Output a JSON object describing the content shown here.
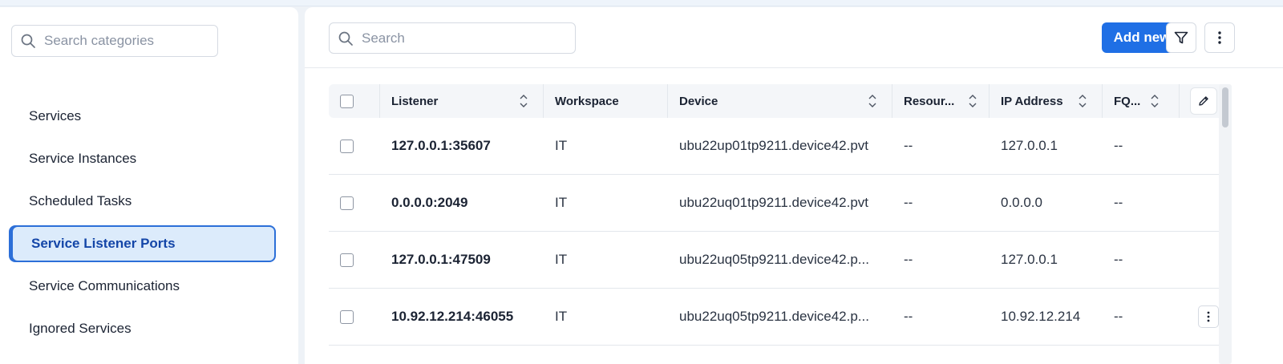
{
  "sidebar": {
    "search_placeholder": "Search categories",
    "items": [
      {
        "label": "Services",
        "active": false
      },
      {
        "label": "Service Instances",
        "active": false
      },
      {
        "label": "Scheduled Tasks",
        "active": false
      },
      {
        "label": "Service Listener Ports",
        "active": true
      },
      {
        "label": "Service Communications",
        "active": false
      },
      {
        "label": "Ignored Services",
        "active": false
      }
    ]
  },
  "toolbar": {
    "search_placeholder": "Search",
    "add_label": "Add new"
  },
  "table": {
    "columns": [
      "Listener",
      "Workspace",
      "Device",
      "Resour...",
      "IP Address",
      "FQ..."
    ],
    "rows": [
      {
        "listener": "127.0.0.1:35607",
        "workspace": "IT",
        "device": "ubu22up01tp9211.device42.pvt",
        "resource": "--",
        "ip": "127.0.0.1",
        "fq": "--"
      },
      {
        "listener": "0.0.0.0:2049",
        "workspace": "IT",
        "device": "ubu22uq01tp9211.device42.pvt",
        "resource": "--",
        "ip": "0.0.0.0",
        "fq": "--"
      },
      {
        "listener": "127.0.0.1:47509",
        "workspace": "IT",
        "device": "ubu22uq05tp9211.device42.p...",
        "resource": "--",
        "ip": "127.0.0.1",
        "fq": "--"
      },
      {
        "listener": "10.92.12.214:46055",
        "workspace": "IT",
        "device": "ubu22uq05tp9211.device42.p...",
        "resource": "--",
        "ip": "10.92.12.214",
        "fq": "--"
      }
    ]
  },
  "colors": {
    "accent": "#1f6fe5",
    "active_bg": "#dcebfb",
    "active_border": "#2c6fd8"
  },
  "icons": [
    "search-icon",
    "filter-icon",
    "kebab-icon",
    "sort-icon",
    "pencil-icon"
  ]
}
